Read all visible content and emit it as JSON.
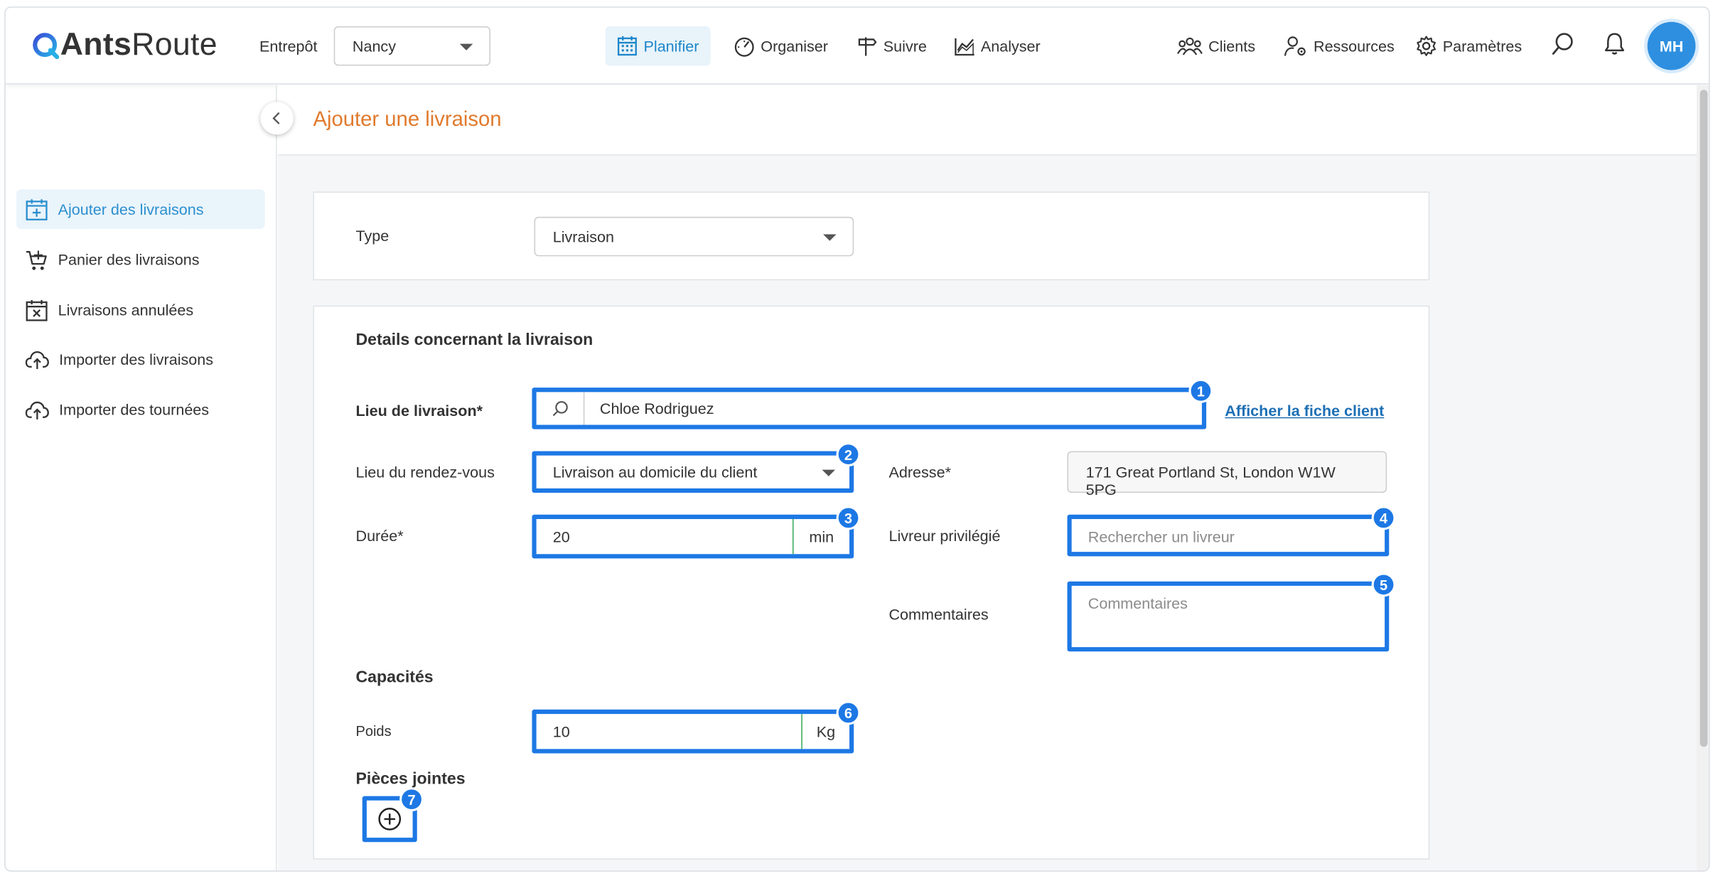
{
  "app": {
    "name_bold": "Ants",
    "name_rest": "Route"
  },
  "topbar": {
    "warehouse_label": "Entrepôt",
    "warehouse_value": "Nancy",
    "nav": [
      "Planifier",
      "Organiser",
      "Suivre",
      "Analyser"
    ],
    "right_nav": [
      "Clients",
      "Ressources",
      "Paramètres"
    ],
    "avatar": "MH"
  },
  "sidebar": {
    "items": [
      "Ajouter des livraisons",
      "Panier des livraisons",
      "Livraisons annulées",
      "Importer des livraisons",
      "Importer des tournées"
    ]
  },
  "page": {
    "title": "Ajouter une livraison"
  },
  "type_card": {
    "label": "Type",
    "value": "Livraison"
  },
  "details": {
    "title": "Details concernant la livraison",
    "lieu_label": "Lieu de livraison*",
    "lieu_value": "Chloe Rodriguez",
    "afficher_link": "Afficher la fiche client",
    "rdv_label": "Lieu du rendez-vous",
    "rdv_value": "Livraison au domicile du client",
    "adresse_label": "Adresse*",
    "adresse_value": "171 Great Portland St, London W1W 5PG",
    "duree_label": "Durée*",
    "duree_value": "20",
    "duree_unit": "min",
    "livreur_label": "Livreur privilégié",
    "livreur_placeholder": "Rechercher un livreur",
    "comment_label": "Commentaires",
    "comment_placeholder": "Commentaires",
    "capacites_title": "Capacités",
    "poids_label": "Poids",
    "poids_value": "10",
    "poids_unit": "Kg",
    "pj_title": "Pièces jointes"
  },
  "badges": [
    "1",
    "2",
    "3",
    "4",
    "5",
    "6",
    "7"
  ],
  "colors": {
    "accent": "#1d86c9",
    "highlight": "#1d78e5",
    "title": "#e07a2d"
  }
}
